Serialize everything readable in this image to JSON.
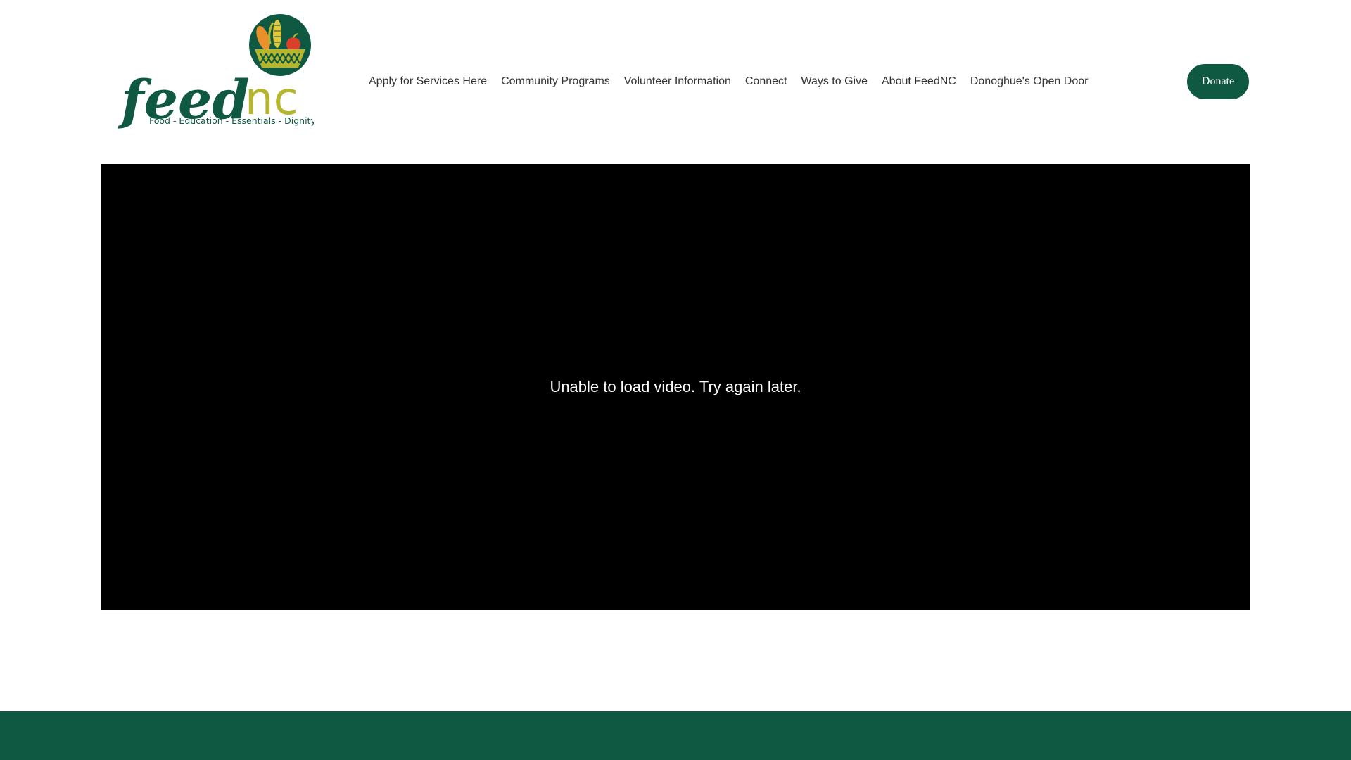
{
  "brand": {
    "logo_wordmark_left": "feed",
    "logo_wordmark_right": "nc",
    "logo_tagline": "Food - Education - Essentials - Dignity",
    "colors": {
      "primary_green": "#0f5842",
      "lime": "#b5b52e",
      "orange": "#e8902a",
      "red": "#d9412b"
    }
  },
  "nav": {
    "items": [
      {
        "label": "Apply for Services Here"
      },
      {
        "label": "Community Programs"
      },
      {
        "label": "Volunteer Information"
      },
      {
        "label": "Connect"
      },
      {
        "label": "Ways to Give"
      },
      {
        "label": "About FeedNC"
      },
      {
        "label": "Donoghue's Open Door"
      }
    ],
    "donate_label": "Donate"
  },
  "video": {
    "message": "Unable to load video. Try again later."
  },
  "footer": {
    "background": "#0f5842"
  }
}
